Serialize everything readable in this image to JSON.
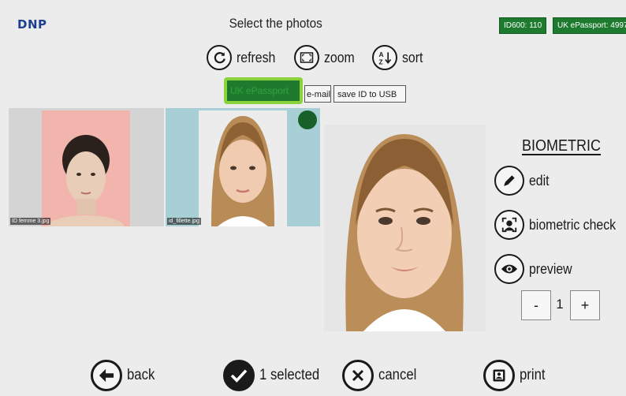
{
  "header": {
    "logo": "DNP",
    "title": "Select the photos",
    "badges": [
      "ID600: 110",
      "UK ePassport: 4997"
    ]
  },
  "toolbar": {
    "refresh_label": "refresh",
    "zoom_label": "zoom",
    "sort_label": "sort"
  },
  "tabs": {
    "active_label": "UK ePassport",
    "email_label": "e-mail",
    "usb_label": "save ID to USB"
  },
  "thumbnails": [
    {
      "filename": "ID femme 3.jpg",
      "selected": false
    },
    {
      "filename": "id_fillette.jpg",
      "selected": true
    }
  ],
  "side_panel": {
    "heading": "BIOMETRIC",
    "edit_label": "edit",
    "biometric_check_label": "biometric check",
    "preview_label": "preview",
    "quantity": "1",
    "minus_label": "-",
    "plus_label": "+"
  },
  "bottom_bar": {
    "back_label": "back",
    "selected_label": "1 selected",
    "cancel_label": "cancel",
    "print_label": "print"
  },
  "colors": {
    "badge_green": "#1e7a2e",
    "highlight_green": "#8ad33a",
    "logo_blue": "#1f3f8f"
  }
}
